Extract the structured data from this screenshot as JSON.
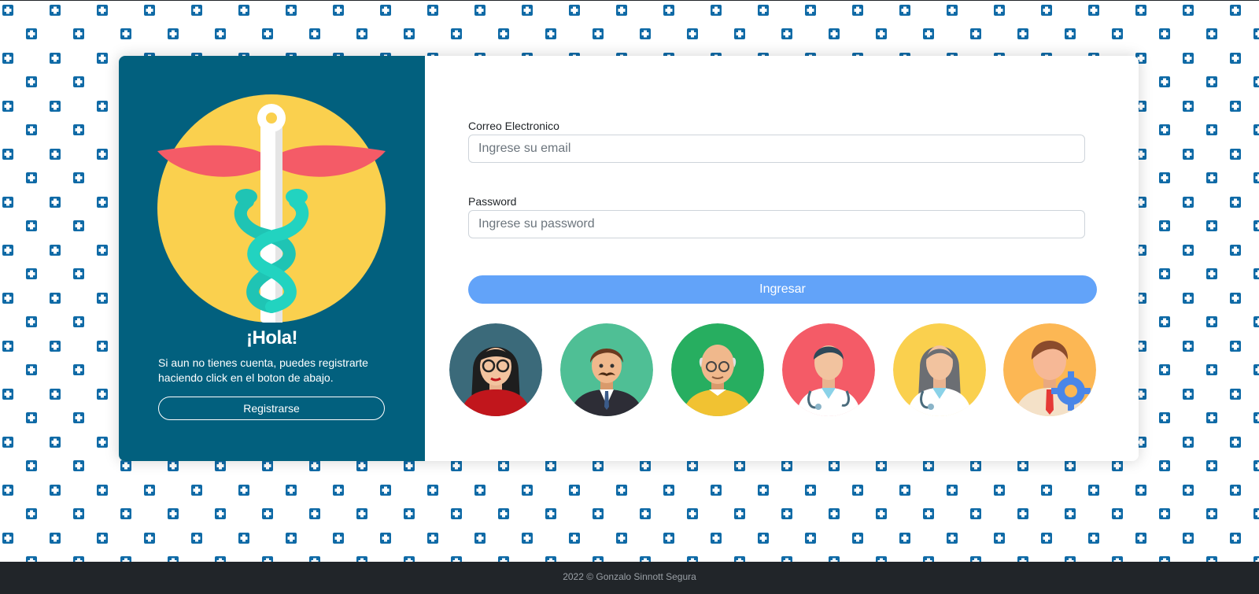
{
  "welcome": {
    "title": "¡Hola!",
    "text": "Si aun no tienes cuenta, puedes registrarte haciendo click en el boton de abajo.",
    "register_label": "Registrarse"
  },
  "login": {
    "email_label": "Correo Electronico",
    "email_placeholder": "Ingrese su email",
    "email_value": "",
    "password_label": "Password",
    "password_placeholder": "Ingrese su password",
    "password_value": "",
    "submit_label": "Ingresar"
  },
  "avatars": [
    "woman-glasses",
    "man-mustache",
    "bald-man",
    "male-doctor",
    "female-doctor",
    "admin-gear"
  ],
  "footer": {
    "text": "2022 © Gonzalo Sinnott Segura"
  },
  "colors": {
    "panel": "#02607e",
    "accent_button": "#62a3f9",
    "pattern_icon": "#0f6aa6",
    "footer_bg": "#212529"
  }
}
